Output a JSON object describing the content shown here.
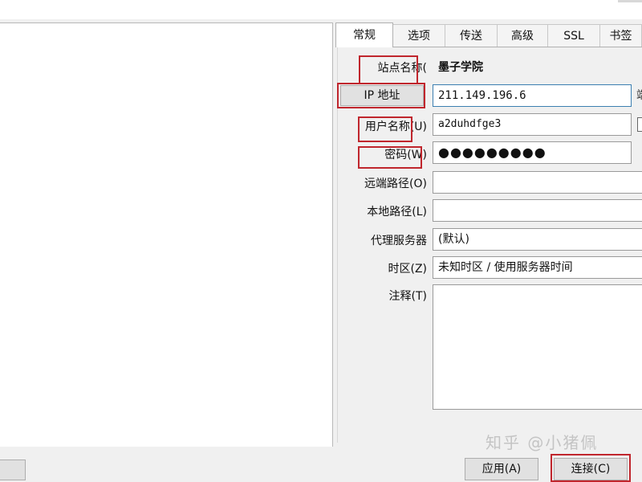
{
  "tabs": [
    {
      "label": "常规",
      "active": true
    },
    {
      "label": "选项",
      "active": false
    },
    {
      "label": "传送",
      "active": false
    },
    {
      "label": "高级",
      "active": false
    },
    {
      "label": "SSL",
      "active": false
    },
    {
      "label": "书签",
      "active": false
    }
  ],
  "form": {
    "site_name_label": "站点名称(",
    "site_name_value": "墨子学院",
    "ip_button_label": "IP 地址",
    "ip_value": "211.149.196.6",
    "username_label": "用户名称(U)",
    "username_value": "a2duhdfge3",
    "password_label": "密码(W)",
    "password_value": "●●●●●●●●●",
    "remote_path_label": "远端路径(O)",
    "remote_path_value": "",
    "local_path_label": "本地路径(L)",
    "local_path_value": "",
    "proxy_label": "代理服务器",
    "proxy_value": "(默认)",
    "timezone_label": "时区(Z)",
    "timezone_value": "未知时区 / 使用服务器时间",
    "comment_label": "注释(T)",
    "comment_value": ""
  },
  "buttons": {
    "apply_label": "应用(A)",
    "connect_label": "连接(C)"
  },
  "watermark": "知乎 @小猪佩",
  "edge_char": "端",
  "colors": {
    "highlight": "#c0262d",
    "focus_border": "#3c7fb1"
  }
}
